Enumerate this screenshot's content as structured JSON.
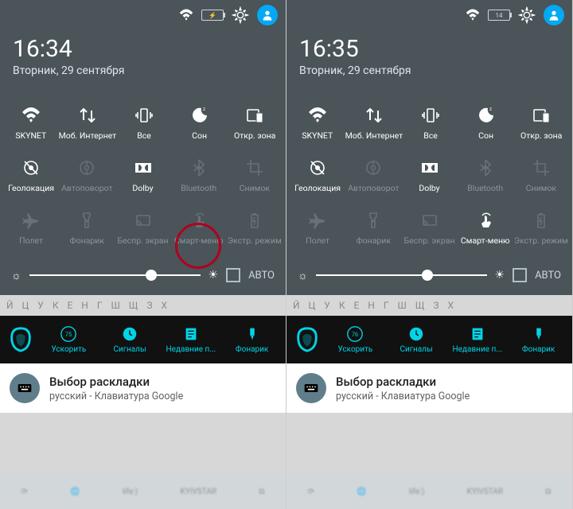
{
  "left": {
    "status": {
      "battery": "⚡"
    },
    "time": "16:34",
    "date": "Вторник, 29 сентября",
    "tiles": [
      [
        {
          "icon": "wifi",
          "label": "SKYNET",
          "active": true
        },
        {
          "icon": "data",
          "label": "Моб. Интернет",
          "active": true
        },
        {
          "icon": "vibrate",
          "label": "Все",
          "active": true
        },
        {
          "icon": "moon",
          "label": "Сон",
          "active": true
        },
        {
          "icon": "screen",
          "label": "Откр. зона",
          "active": true
        }
      ],
      [
        {
          "icon": "location",
          "label": "Геолокация",
          "active": true
        },
        {
          "icon": "rotate",
          "label": "Автоповорот",
          "active": false
        },
        {
          "icon": "dolby",
          "label": "Dolby",
          "active": true
        },
        {
          "icon": "bluetooth",
          "label": "Bluetooth",
          "active": false
        },
        {
          "icon": "crop",
          "label": "Снимок",
          "active": false
        }
      ],
      [
        {
          "icon": "plane",
          "label": "Полет",
          "active": false
        },
        {
          "icon": "torch",
          "label": "Фонарик",
          "active": false
        },
        {
          "icon": "cast",
          "label": "Беспр. экран",
          "active": false
        },
        {
          "icon": "touch",
          "label": "Смарт-меню",
          "active": false
        },
        {
          "icon": "battery",
          "label": "Экстр. режим",
          "active": false
        }
      ]
    ],
    "auto_label": "АВТО",
    "quick": {
      "items": [
        {
          "icon": "speed",
          "label": "Ускорить",
          "value": "75"
        },
        {
          "icon": "clock",
          "label": "Сигналы"
        },
        {
          "icon": "recent",
          "label": "Недавние п..."
        },
        {
          "icon": "flash",
          "label": "Фонарик"
        }
      ]
    },
    "notification": {
      "title": "Выбор раскладки",
      "subtitle": "русский - Клавиатура Google"
    },
    "highlight_tile": true
  },
  "right": {
    "status": {
      "battery": "14"
    },
    "time": "16:35",
    "date": "Вторник, 29 сентября",
    "tiles": [
      [
        {
          "icon": "wifi",
          "label": "SKYNET",
          "active": true
        },
        {
          "icon": "data",
          "label": "Моб. Интернет",
          "active": true
        },
        {
          "icon": "vibrate",
          "label": "Все",
          "active": true
        },
        {
          "icon": "moon",
          "label": "Сон",
          "active": true
        },
        {
          "icon": "screen",
          "label": "Откр. зона",
          "active": true
        }
      ],
      [
        {
          "icon": "location",
          "label": "Геолокация",
          "active": true
        },
        {
          "icon": "rotate",
          "label": "Автоповорот",
          "active": false
        },
        {
          "icon": "dolby",
          "label": "Dolby",
          "active": true
        },
        {
          "icon": "bluetooth",
          "label": "Bluetooth",
          "active": false
        },
        {
          "icon": "crop",
          "label": "Снимок",
          "active": false
        }
      ],
      [
        {
          "icon": "plane",
          "label": "Полет",
          "active": false
        },
        {
          "icon": "torch",
          "label": "Фонарик",
          "active": false
        },
        {
          "icon": "cast",
          "label": "Беспр. экран",
          "active": false
        },
        {
          "icon": "touch",
          "label": "Смарт-меню",
          "active": true
        },
        {
          "icon": "battery",
          "label": "Экстр. режим",
          "active": false
        }
      ]
    ],
    "auto_label": "АВТО",
    "quick": {
      "items": [
        {
          "icon": "speed",
          "label": "Ускорить",
          "value": "76"
        },
        {
          "icon": "clock",
          "label": "Сигналы"
        },
        {
          "icon": "recent",
          "label": "Недавние п..."
        },
        {
          "icon": "flash",
          "label": "Фонарик"
        }
      ]
    },
    "notification": {
      "title": "Выбор раскладки",
      "subtitle": "русский - Клавиатура Google"
    },
    "highlight_tile": false
  },
  "taskbar": {
    "items": [
      "life:)",
      "KYIVSTAR"
    ]
  },
  "kb_preview": "Й Ц У К Е Н Г Ш Щ З Х"
}
